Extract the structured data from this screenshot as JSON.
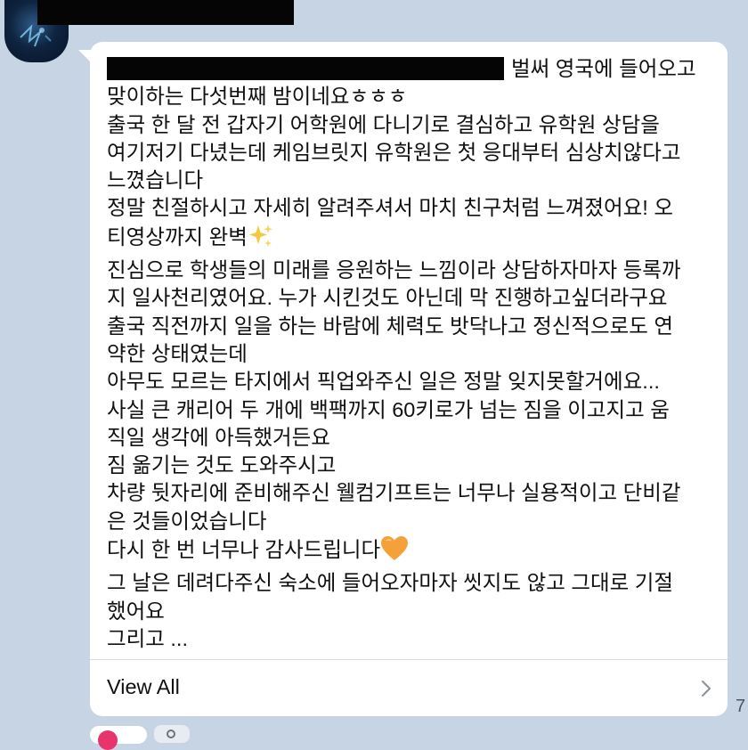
{
  "post": {
    "avatar_icon": "avatar-image",
    "sender_name_redacted": true,
    "lines": {
      "l1_after_redaction": "벌써 영국에 들어오고",
      "l2": "맞이하는 다섯번째 밤이네요ㅎㅎㅎ",
      "l3": "출국 한 달 전 갑자기 어학원에 다니기로 결심하고 유학원 상담을",
      "l4": "여기저기 다녔는데 케임브릿지 유학원은 첫 응대부터 심상치않다고",
      "l5": "느꼈습니다",
      "l6": "정말 친절하시고 자세히 알려주셔서 마치 친구처럼 느껴졌어요! 오",
      "l7": "티영상까지 완벽",
      "l8": "진심으로 학생들의 미래를 응원하는 느낌이라 상담하자마자 등록까",
      "l9": "지 일사천리였어요. 누가 시킨것도 아닌데 막 진행하고싶더라구요",
      "l10": "출국 직전까지 일을 하는 바람에 체력도 밧닥나고 정신적으로도 연",
      "l11": "약한 상태였는데",
      "l12": "아무도 모르는 타지에서 픽업와주신 일은 정말 잊지못할거에요...",
      "l13": "사실 큰 캐리어 두 개에 백팩까지 60키로가 넘는 짐을 이고지고 움",
      "l14": "직일 생각에 아득했거든요",
      "l15": "짐 옮기는 것도 도와주시고",
      "l16": "차량 뒷자리에 준비해주신 웰컴기프트는 너무나 실용적이고 단비같",
      "l17": "은 것들이었습니다",
      "l18": "다시 한 번 너무나 감사드립니다",
      "l19": "그 날은 데려다주신 숙소에 들어오자마자 씻지도 않고 그대로 기절",
      "l20": "했어요",
      "l21": "그리고 ..."
    },
    "emoji_sparkles": "sparkles-emoji",
    "emoji_heart": "orange-heart-emoji",
    "view_all_label": "View All",
    "chevron_icon": "chevron-right-icon",
    "side_number": "7"
  },
  "colors": {
    "background": "#c6d4e4",
    "bubble": "#ffffff",
    "text": "#111111",
    "heart": "#f4a13a",
    "sparkle": "#f5c842",
    "reaction_pink": "#e8336d"
  }
}
